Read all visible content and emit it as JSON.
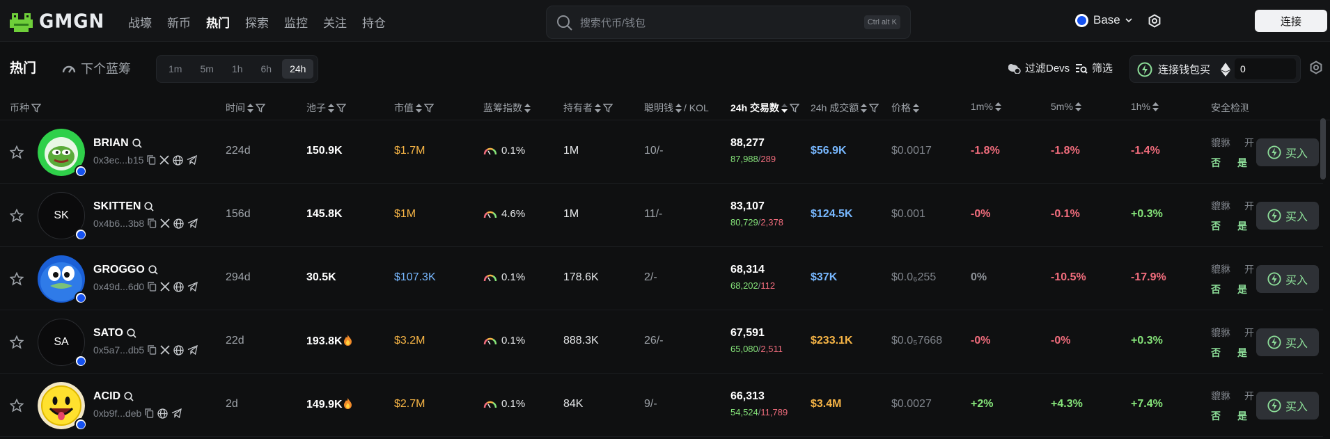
{
  "nav": {
    "logo_text": "GMGN",
    "links": [
      "战壕",
      "新币",
      "热门",
      "探索",
      "监控",
      "关注",
      "持仓"
    ],
    "active_link": "热门",
    "search_placeholder": "搜索代币/钱包",
    "search_shortcut": "Ctrl alt K",
    "chain": "Base",
    "connect_label": "连接"
  },
  "toolbar": {
    "title": "热门",
    "blue_chip_label": "下个蓝筹",
    "timeframes": [
      "1m",
      "5m",
      "1h",
      "6h",
      "24h"
    ],
    "active_timeframe": "24h",
    "filter_devs_label": "过滤Devs",
    "filter_label": "筛选",
    "wallet_buy_label": "连接钱包买",
    "buy_amount": "0"
  },
  "columns": {
    "token": "币种",
    "age": "时间",
    "pool": "池子",
    "mcap": "市值",
    "blue_chip": "蓝筹指数",
    "holders": "持有者",
    "smart": "聪明钱",
    "kol": "/ KOL",
    "tx24": "24h 交易数",
    "vol24": "24h 成交额",
    "price": "价格",
    "c1m": "1m%",
    "c5m": "5m%",
    "c1h": "1h%",
    "security": "安全检测"
  },
  "rows": [
    {
      "name": "BRIAN",
      "addr": "0x3ec...b15",
      "avatar": "pepe-logo",
      "age": "224d",
      "pool": "150.9K",
      "pool_hot": false,
      "mcap": "$1.7M",
      "mcap_color": "#f7b546",
      "blue": "0.1%",
      "holders": "1M",
      "smart": "10",
      "smart_sep": "/-",
      "tx": "88,277",
      "buys": "87,988",
      "sells": "289",
      "vol": "$56.9K",
      "vol_color": "#78b8ff",
      "price": "$0.0017",
      "c1m": "-1.8%",
      "c1m_color": "#f26d7d",
      "c5m": "-1.8%",
      "c5m_color": "#f26d7d",
      "c1h": "-1.4%",
      "c1h_color": "#f26d7d",
      "sec_a": "貔貅",
      "sec_b": "开",
      "sec_c": "否",
      "sec_d": "是"
    },
    {
      "name": "SKITTEN",
      "addr": "0x4b6...3b8",
      "avatar_text": "SK",
      "age": "156d",
      "pool": "145.8K",
      "pool_hot": false,
      "mcap": "$1M",
      "mcap_color": "#f7b546",
      "blue": "4.6%",
      "holders": "1M",
      "smart": "11",
      "smart_sep": "/-",
      "tx": "83,107",
      "buys": "80,729",
      "sells": "2,378",
      "vol": "$124.5K",
      "vol_color": "#78b8ff",
      "price": "$0.001",
      "c1m": "-0%",
      "c1m_color": "#f26d7d",
      "c5m": "-0.1%",
      "c5m_color": "#f26d7d",
      "c1h": "+0.3%",
      "c1h_color": "#86e57a",
      "sec_a": "貔貅",
      "sec_b": "开",
      "sec_c": "否",
      "sec_d": "是"
    },
    {
      "name": "GROGGO",
      "addr": "0x49d...6d0",
      "avatar": "blue-blob",
      "age": "294d",
      "pool": "30.5K",
      "pool_hot": false,
      "mcap": "$107.3K",
      "mcap_color": "#78b8ff",
      "blue": "0.1%",
      "holders": "178.6K",
      "smart": "2",
      "smart_sep": "/-",
      "tx": "68,314",
      "buys": "68,202",
      "sells": "112",
      "vol": "$37K",
      "vol_color": "#78b8ff",
      "price": "$0.0₆255",
      "c1m": "0%",
      "c1m_color": "#8d9197",
      "c5m": "-10.5%",
      "c5m_color": "#f26d7d",
      "c1h": "-17.9%",
      "c1h_color": "#f26d7d",
      "sec_a": "貔貅",
      "sec_b": "开",
      "sec_c": "否",
      "sec_d": "是"
    },
    {
      "name": "SATO",
      "addr": "0x5a7...db5",
      "avatar_text": "SA",
      "age": "22d",
      "pool": "193.8K",
      "pool_hot": true,
      "mcap": "$3.2M",
      "mcap_color": "#f7b546",
      "blue": "0.1%",
      "holders": "888.3K",
      "smart": "26",
      "smart_sep": "/-",
      "tx": "67,591",
      "buys": "65,080",
      "sells": "2,511",
      "vol": "$233.1K",
      "vol_color": "#f7b546",
      "price": "$0.0₅7668",
      "c1m": "-0%",
      "c1m_color": "#f26d7d",
      "c5m": "-0%",
      "c5m_color": "#f26d7d",
      "c1h": "+0.3%",
      "c1h_color": "#86e57a",
      "sec_a": "貔貅",
      "sec_b": "开",
      "sec_c": "否",
      "sec_d": "是"
    },
    {
      "name": "ACID",
      "addr": "0xb9f...deb",
      "avatar": "smiley",
      "age": "2d",
      "pool": "149.9K",
      "pool_hot": true,
      "mcap": "$2.7M",
      "mcap_color": "#f7b546",
      "blue": "0.1%",
      "holders": "84K",
      "smart": "9",
      "smart_sep": "/-",
      "tx": "66,313",
      "buys": "54,524",
      "sells": "11,789",
      "vol": "$3.4M",
      "vol_color": "#f7b546",
      "price": "$0.0027",
      "c1m": "+2%",
      "c1m_color": "#86e57a",
      "c5m": "+4.3%",
      "c5m_color": "#86e57a",
      "c1h": "+7.4%",
      "c1h_color": "#86e57a",
      "sec_a": "貔貅",
      "sec_b": "开",
      "sec_c": "否",
      "sec_d": "是"
    }
  ],
  "buy_label": "买入"
}
